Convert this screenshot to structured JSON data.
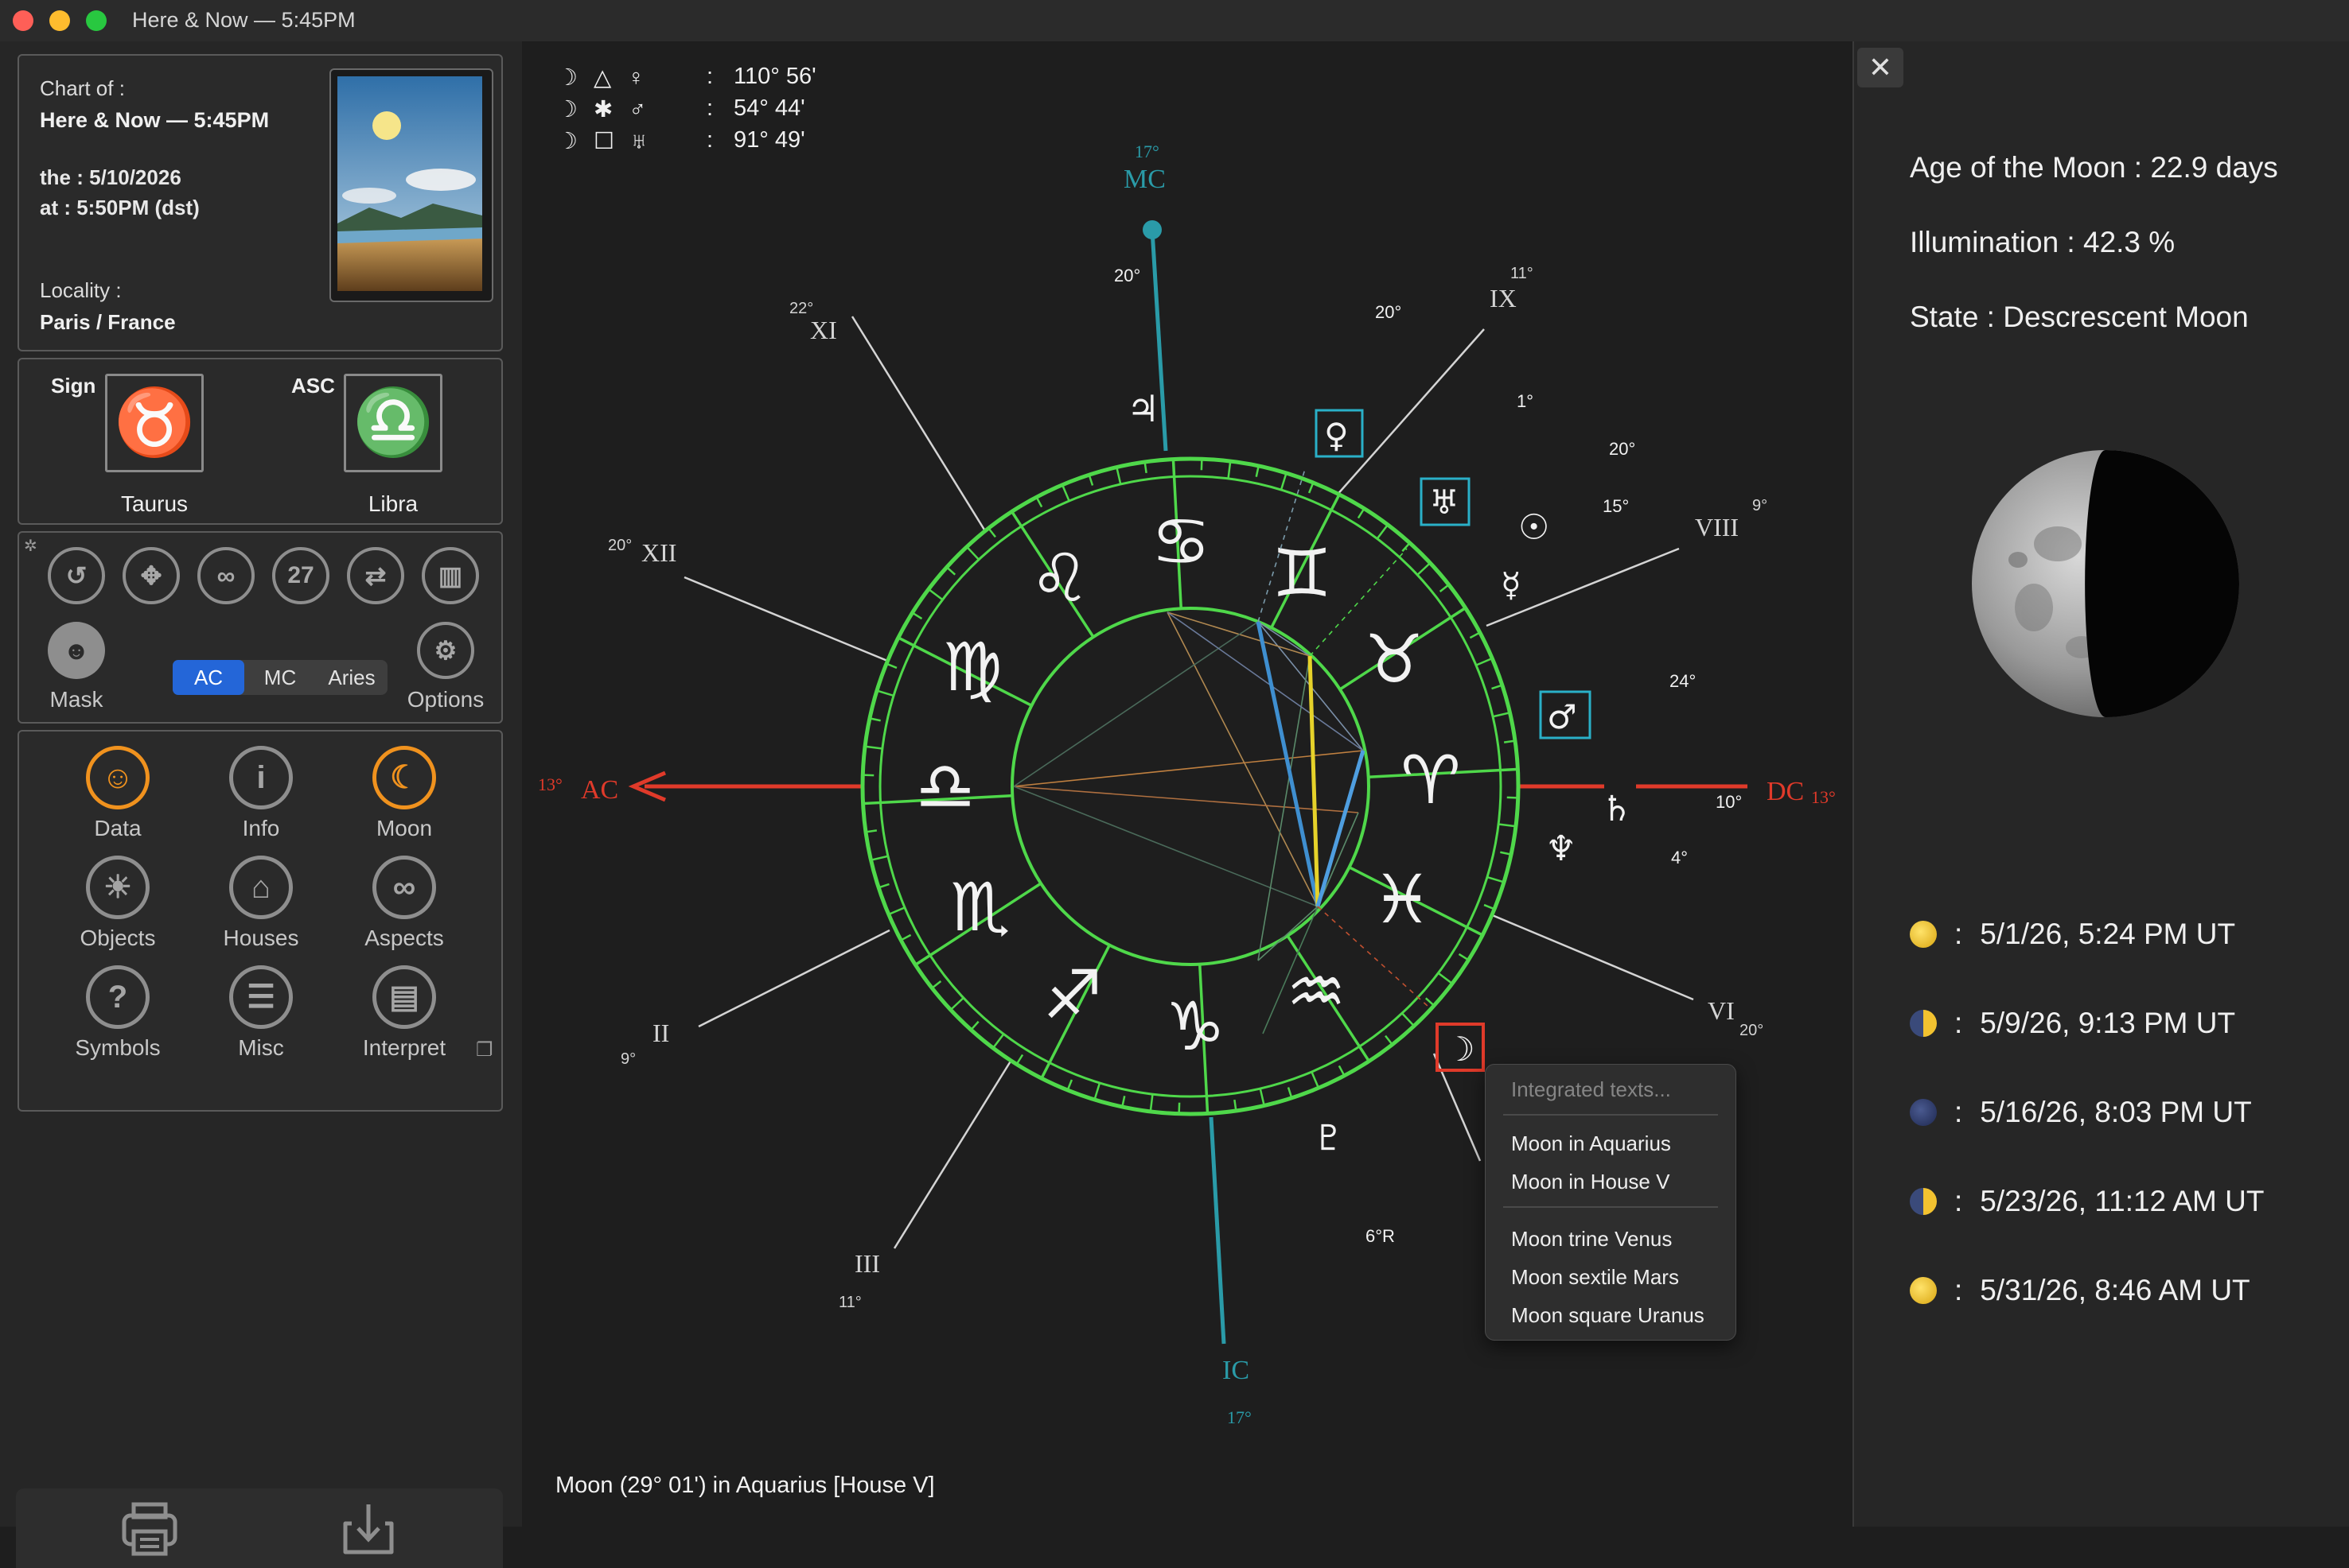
{
  "window": {
    "title": "Here & Now — 5:45PM"
  },
  "chart_info": {
    "chart_of_label": "Chart of :",
    "chart_name": "Here & Now — 5:45PM",
    "date": "the : 5/10/2026",
    "time": "at : 5:50PM (dst)",
    "locality_label": "Locality :",
    "locality": "Paris / France"
  },
  "sign_panel": {
    "sign_label": "Sign",
    "sign_glyph": "♉",
    "sign_name": "Taurus",
    "asc_label": "ASC",
    "asc_glyph": "♎",
    "asc_name": "Libra"
  },
  "toolbar": {
    "tools": [
      {
        "name": "reset",
        "glyph": "↺"
      },
      {
        "name": "move",
        "glyph": "✥"
      },
      {
        "name": "link",
        "glyph": "∞"
      },
      {
        "name": "date-27",
        "glyph": "27"
      },
      {
        "name": "swap",
        "glyph": "⇄"
      },
      {
        "name": "library",
        "glyph": "▥"
      }
    ],
    "mask_label": "Mask",
    "options_label": "Options",
    "segments": [
      "AC",
      "MC",
      "Aries"
    ],
    "selected_segment": "AC"
  },
  "nav": {
    "items": [
      {
        "label": "Data",
        "glyph": "☺"
      },
      {
        "label": "Info",
        "glyph": "i"
      },
      {
        "label": "Moon",
        "glyph": "☾"
      },
      {
        "label": "Objects",
        "glyph": "☀"
      },
      {
        "label": "Houses",
        "glyph": "⌂"
      },
      {
        "label": "Aspects",
        "glyph": "∞"
      },
      {
        "label": "Symbols",
        "glyph": "?"
      },
      {
        "label": "Misc",
        "glyph": "☰"
      },
      {
        "label": "Interpret",
        "glyph": "▤"
      }
    ]
  },
  "aspect_readout": [
    {
      "glyphs": "☽ △ ♀",
      "sep": ":",
      "value": "110° 56'"
    },
    {
      "glyphs": "☽ ✱ ♂",
      "sep": ":",
      "value": "54° 44'"
    },
    {
      "glyphs": "☽ ☐ ♅",
      "sep": ":",
      "value": "91° 49'"
    }
  ],
  "chart": {
    "zodiac_glyphs": [
      "♋",
      "♊",
      "♉",
      "♈",
      "♓",
      "♒",
      "♑",
      "♐",
      "♏",
      "♎",
      "♍",
      "♌"
    ],
    "angles": {
      "mc_label": "MC",
      "mc_degree": "17°",
      "ic_label": "IC",
      "ic_degree": "17°",
      "ac_label": "AC",
      "ac_degree": "13°",
      "dc_label": "DC",
      "dc_degree": "13°"
    },
    "houses": [
      {
        "label": "XI",
        "degree": "22°"
      },
      {
        "label": "IX",
        "degree": "11°"
      },
      {
        "label": "XII",
        "degree": "20°"
      },
      {
        "label": "VIII",
        "degree": "9°"
      },
      {
        "label": "II",
        "degree": "9°"
      },
      {
        "label": "VI",
        "degree": "20°"
      },
      {
        "label": "III",
        "degree": "11°"
      }
    ],
    "planets": [
      {
        "name": "Jupiter",
        "glyph": "♃",
        "degree": "20°"
      },
      {
        "name": "Venus",
        "glyph": "♀",
        "degree": "20°"
      },
      {
        "name": "Uranus",
        "glyph": "♅",
        "degree": "1°"
      },
      {
        "name": "Sun",
        "glyph": "☉",
        "degree": "20°"
      },
      {
        "name": "Mercury",
        "glyph": "☿",
        "degree": "15°"
      },
      {
        "name": "Mars",
        "glyph": "♂",
        "degree": "24°"
      },
      {
        "name": "Saturn",
        "glyph": "♄",
        "degree": "10°"
      },
      {
        "name": "Neptune",
        "glyph": "♆",
        "degree": "4°"
      },
      {
        "name": "Moon",
        "glyph": "☽"
      },
      {
        "name": "Pluto",
        "glyph": "♇",
        "degree": "6°R"
      }
    ]
  },
  "popup": {
    "header": "Integrated texts...",
    "items": [
      "Moon in Aquarius",
      "Moon in House V",
      "Moon trine Venus",
      "Moon sextile Mars",
      "Moon square Uranus"
    ]
  },
  "status": "Moon (29° 01') in Aquarius [House V]",
  "moon_panel": {
    "close": "✕",
    "age": "Age of the Moon : 22.9 days",
    "illumination": "Illumination : 42.3 %",
    "illumination_fraction": 0.423,
    "state": "State : Descrescent Moon",
    "phases": [
      {
        "sep": ":",
        "date": "5/1/26, 5:24 PM UT",
        "color": "#f2c230"
      },
      {
        "sep": ":",
        "date": "5/9/26, 9:13 PM UT",
        "color": "#f2c230"
      },
      {
        "sep": ":",
        "date": "5/16/26, 8:03 PM UT",
        "color": "#3a4a7a"
      },
      {
        "sep": ":",
        "date": "5/23/26, 11:12 AM UT",
        "color": "#f2c230"
      },
      {
        "sep": ":",
        "date": "5/31/26, 8:46 AM UT",
        "color": "#f2c230"
      }
    ]
  }
}
